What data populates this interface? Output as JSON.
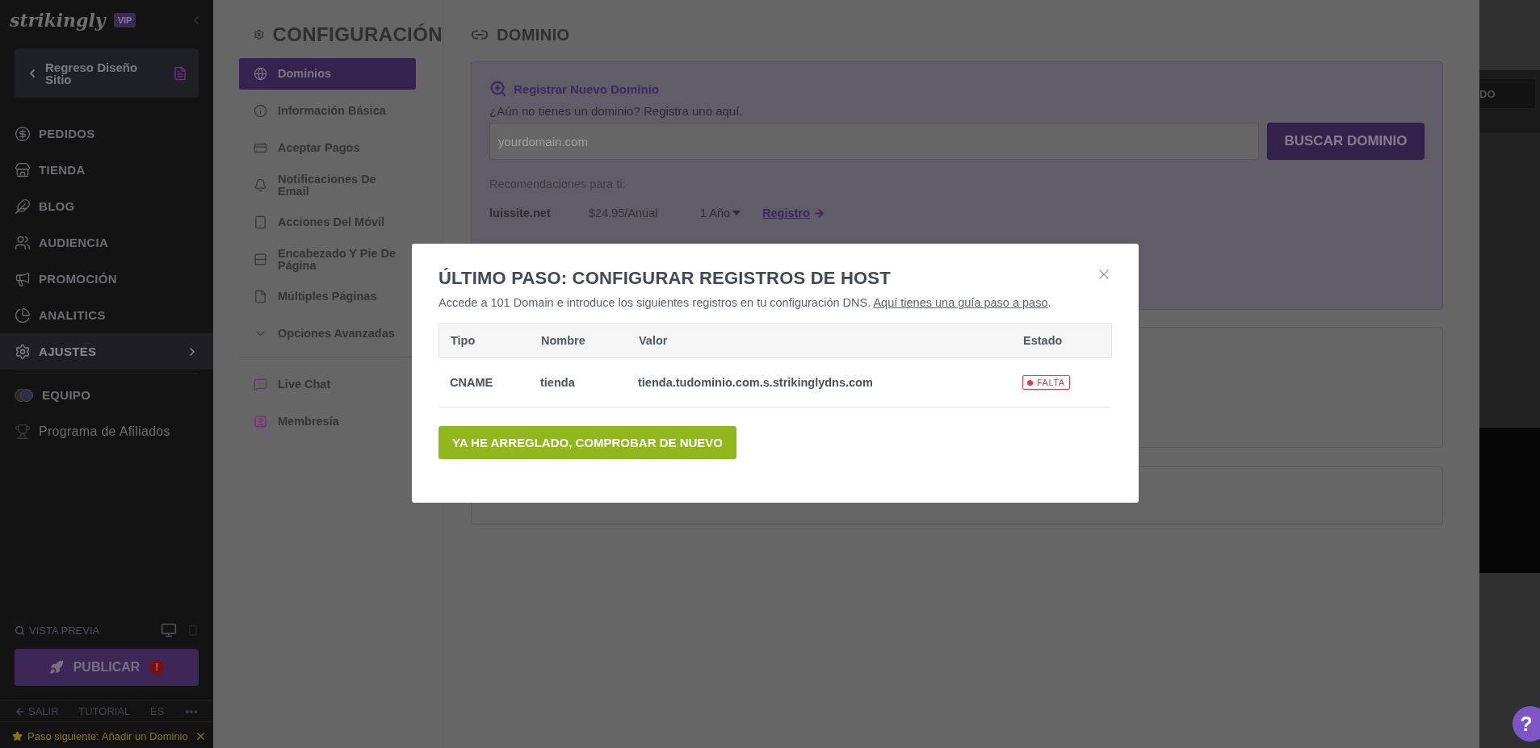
{
  "sidebar": {
    "logo": "strikingly",
    "badge": "VIP",
    "back_button": "Regreso Diseño Sitio",
    "items": [
      {
        "label": "PEDIDOS",
        "selected": false
      },
      {
        "label": "TIENDA",
        "selected": false
      },
      {
        "label": "BLOG",
        "selected": false
      },
      {
        "label": "AUDIENCIA",
        "selected": false
      },
      {
        "label": "PROMOCIÓN",
        "selected": false
      },
      {
        "label": "ANALITICS",
        "selected": false
      },
      {
        "label": "AJUSTES",
        "selected": true
      }
    ],
    "extra_items": [
      {
        "label": "EQUIPO",
        "kind": "caps"
      },
      {
        "label": "Programa de Afiliados",
        "kind": "plain"
      }
    ],
    "preview": "VISTA PREVIA",
    "publish_button": "PUBLICAR",
    "publish_alert": "!",
    "footer": {
      "exit": "SALIR",
      "tutorial": "TUTORIAL",
      "language": "ES"
    },
    "tip": "Paso siguiente: Añadir un Dominio"
  },
  "settings_nav": {
    "title": "CONFIGURACIÓN",
    "items": [
      {
        "label": "Dominios",
        "selected": true
      },
      {
        "label": "Información Básica",
        "selected": false
      },
      {
        "label": "Aceptar Pagos",
        "selected": false
      },
      {
        "label": "Notificaciones De Email",
        "selected": false
      },
      {
        "label": "Acciones Del Móvil",
        "selected": false
      },
      {
        "label": "Encabezado Y Pie De Página",
        "selected": false
      },
      {
        "label": "Múltiples Páginas",
        "selected": false
      },
      {
        "label": "Opciones Avanzadas",
        "selected": false
      }
    ],
    "extras": [
      "Live Chat",
      "Membresía"
    ]
  },
  "domain": {
    "title": "DOMINIO",
    "register_title": "Registrar Nuevo Dominio",
    "register_subtitle": "¿Aún no tienes un dominio? Registra uno aquí.",
    "search": {
      "placeholder": "yourdomain.com"
    },
    "search_button": "BUSCAR DOMINIO",
    "recommendations_label": "Recomendaciones para ti:",
    "recommendation": {
      "domain": "luissite.net",
      "price": "$24.95/Anual",
      "period": "1 Año",
      "link": "Registro"
    }
  },
  "preview": {
    "button": "DO"
  },
  "modal": {
    "title": "ÚLTIMO PASO: CONFIGURAR REGISTROS DE HOST",
    "description": "Accede a 101 Domain e introduce los siguientes registros en tu configuración DNS.",
    "guide_link": "Aquí tienes una guía paso a paso",
    "guide_end": ".",
    "columns": [
      "Tipo",
      "Nombre",
      "Valor",
      "Estado"
    ],
    "rows": [
      {
        "type": "CNAME",
        "name": "tienda",
        "value": "tienda.tudominio.com.s.strikinglydns.com",
        "status": "FALTA"
      }
    ],
    "button": "YA HE ARREGLADO, COMPROBAR DE NUEVO"
  },
  "help_button": "?"
}
